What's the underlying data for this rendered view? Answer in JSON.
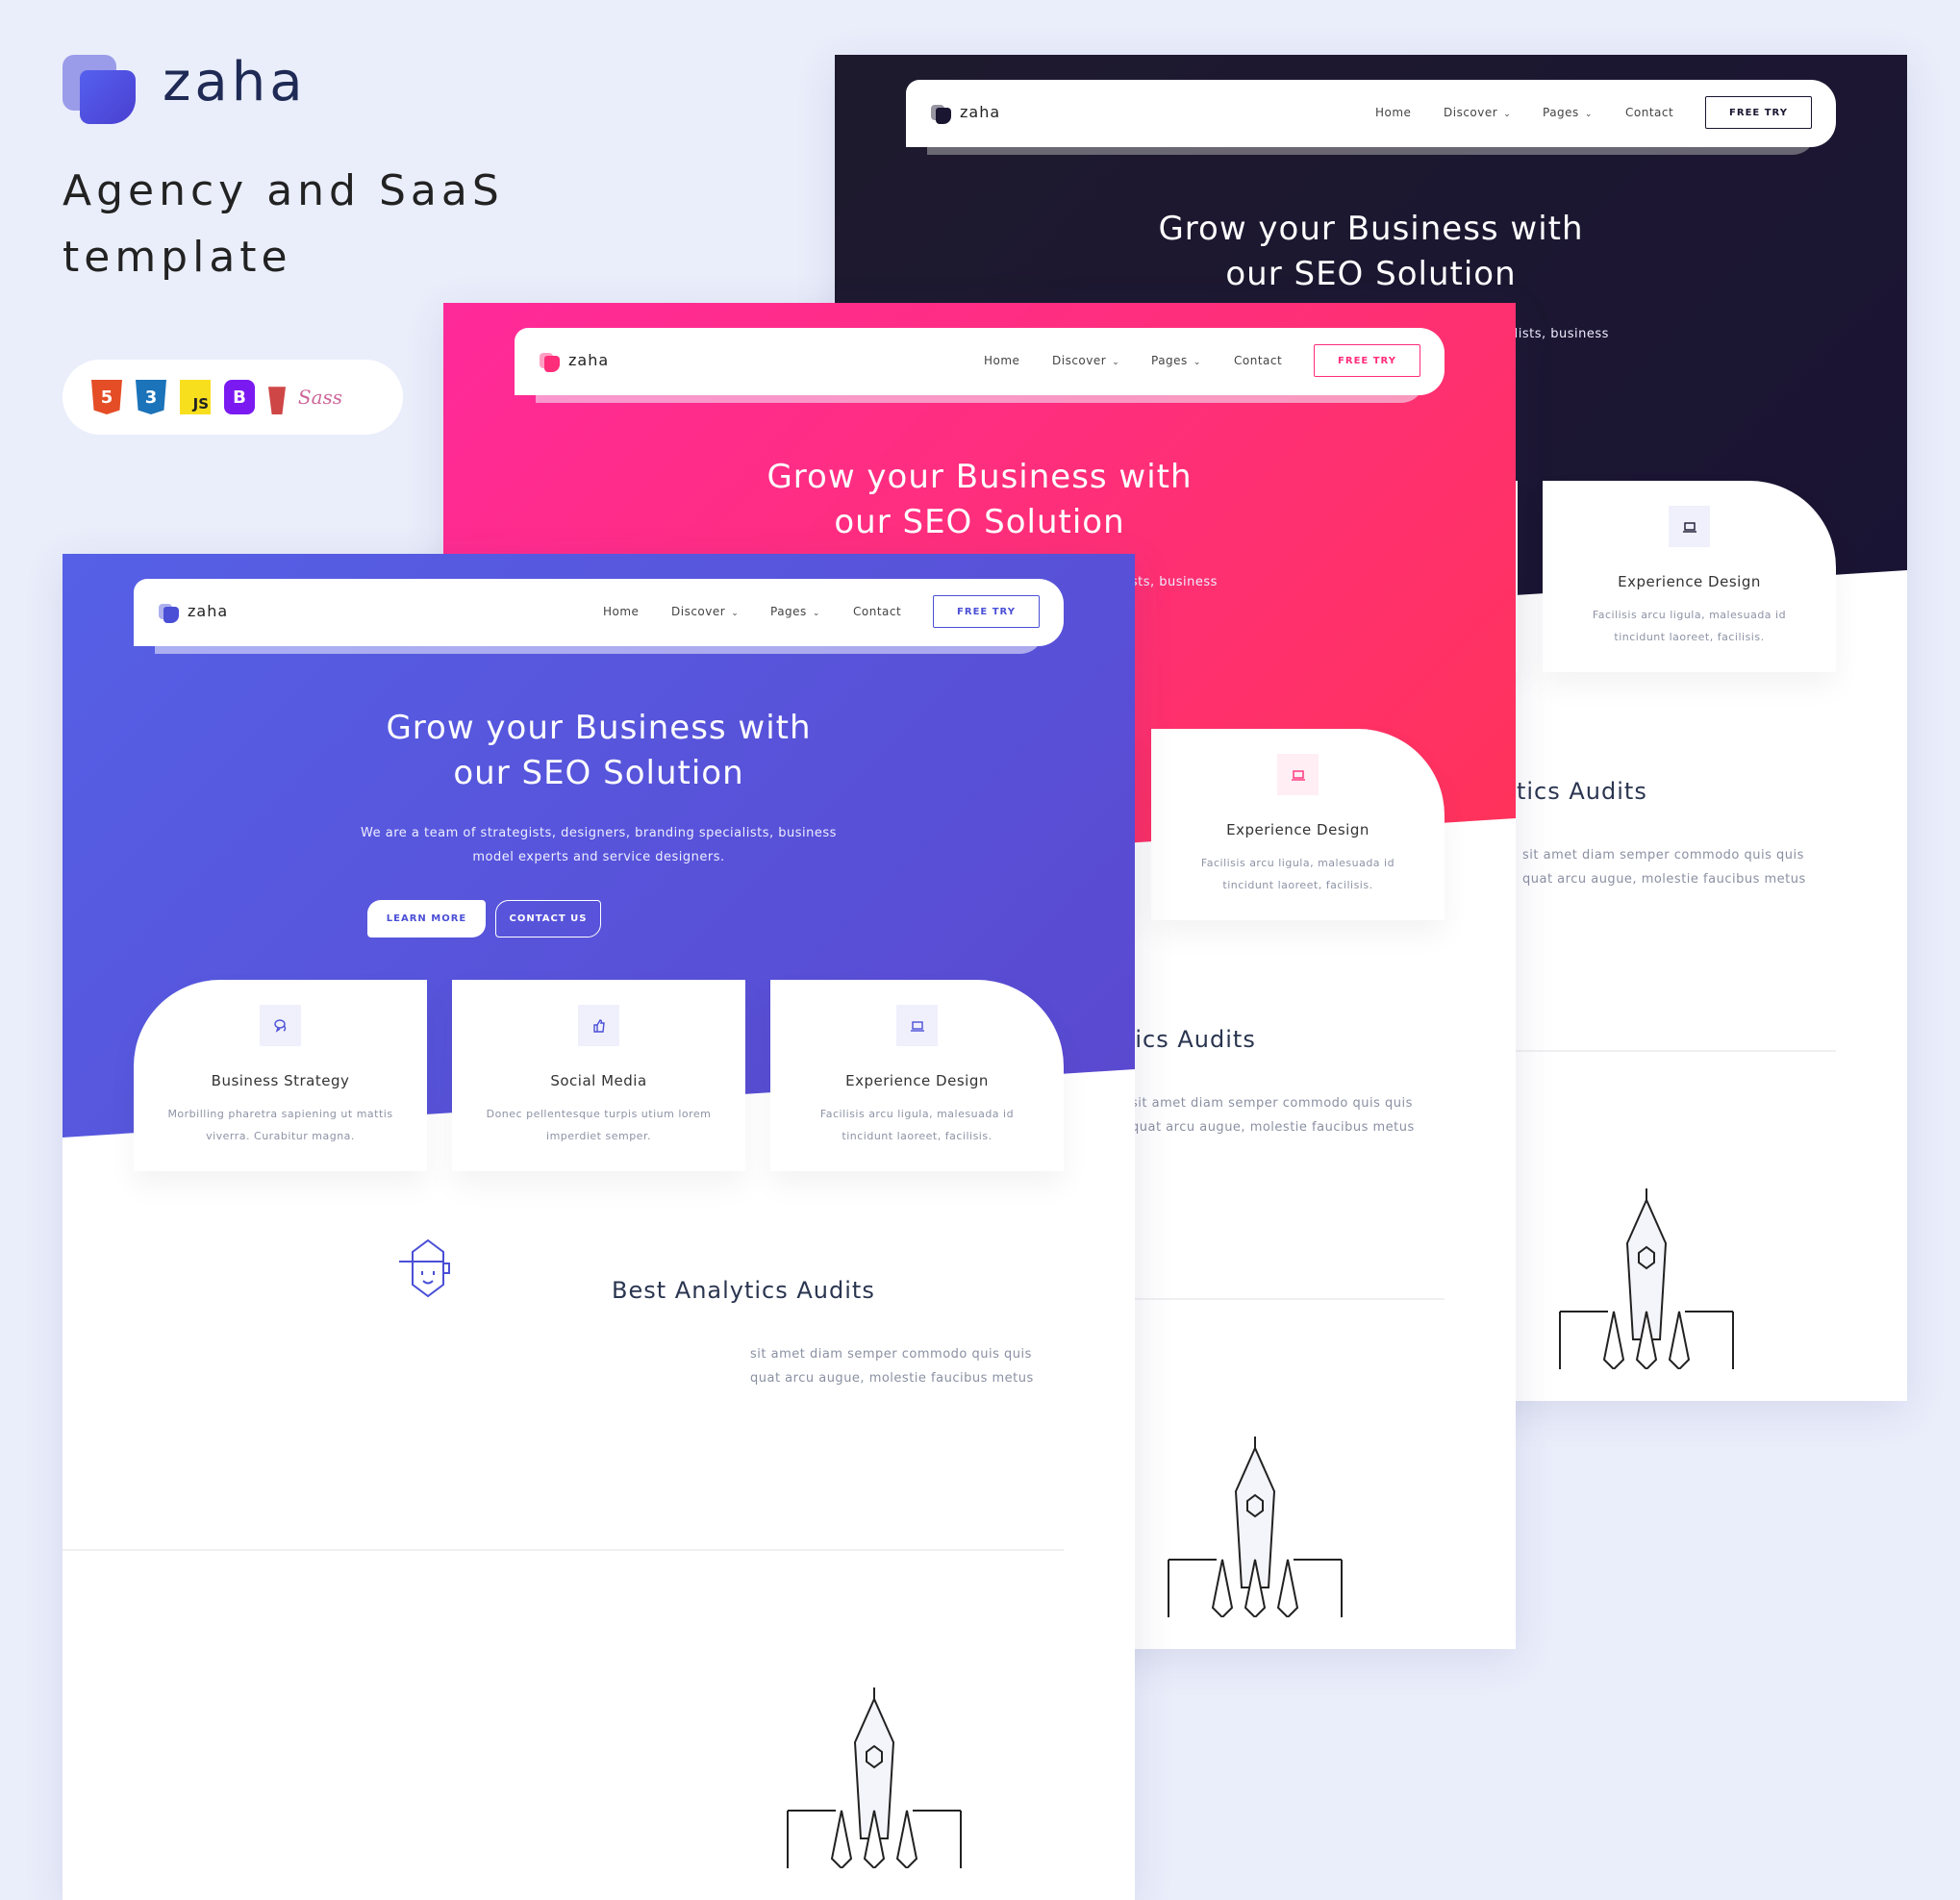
{
  "brand": {
    "name": "zaha",
    "tagline_line1": "Agency and SaaS",
    "tagline_line2": "template"
  },
  "tech_icons": [
    {
      "name": "html5-icon",
      "label": "5"
    },
    {
      "name": "css3-icon",
      "label": "3"
    },
    {
      "name": "javascript-icon",
      "label": "JS"
    },
    {
      "name": "bootstrap-icon",
      "label": "B"
    },
    {
      "name": "gulp-icon",
      "label": ""
    },
    {
      "name": "sass-icon",
      "label": "Sass"
    }
  ],
  "site": {
    "logo": "zaha",
    "nav": {
      "home": "Home",
      "discover": "Discover",
      "pages": "Pages",
      "contact": "Contact",
      "cta": "FREE TRY",
      "chevron": "⌄"
    },
    "hero": {
      "title_line1": "Grow your Business with",
      "title_line2": "our SEO Solution",
      "subtitle_line1": "We are a team of strategists, designers, branding specialists, business",
      "subtitle_line2": "model experts and service designers.",
      "learn_more": "LEARN MORE",
      "contact_us": "CONTACT US"
    },
    "cards": [
      {
        "icon": "chat-icon",
        "title": "Business Strategy",
        "desc_line1": "Morbilling pharetra sapiening ut mattis",
        "desc_line2": "viverra. Curabitur magna."
      },
      {
        "icon": "thumbs-up-icon",
        "title": "Social Media",
        "desc_line1": "Donec pellentesque turpis utium lorem",
        "desc_line2": "imperdiet semper."
      },
      {
        "icon": "laptop-icon",
        "title": "Experience Design",
        "desc_line1": "Facilisis arcu ligula, malesuada id",
        "desc_line2": "tincidunt laoreet, facilisis."
      }
    ],
    "analytics": {
      "heading": "Best Analytics Audits",
      "para_line1": "sit amet diam semper commodo quis quis",
      "para_line2": "quat arcu augue, molestie faucibus metus"
    }
  },
  "themes": [
    {
      "name": "dark",
      "hero_from": "#1e1a2e",
      "hero_to": "#1a1434",
      "accent": "#1a1530"
    },
    {
      "name": "pink",
      "hero_from": "#ff2a9a",
      "hero_to": "#ff3358",
      "accent": "#ff2d7a"
    },
    {
      "name": "blue",
      "hero_from": "#5560e6",
      "hero_to": "#5a48cf",
      "accent": "#4a4fd6"
    }
  ]
}
